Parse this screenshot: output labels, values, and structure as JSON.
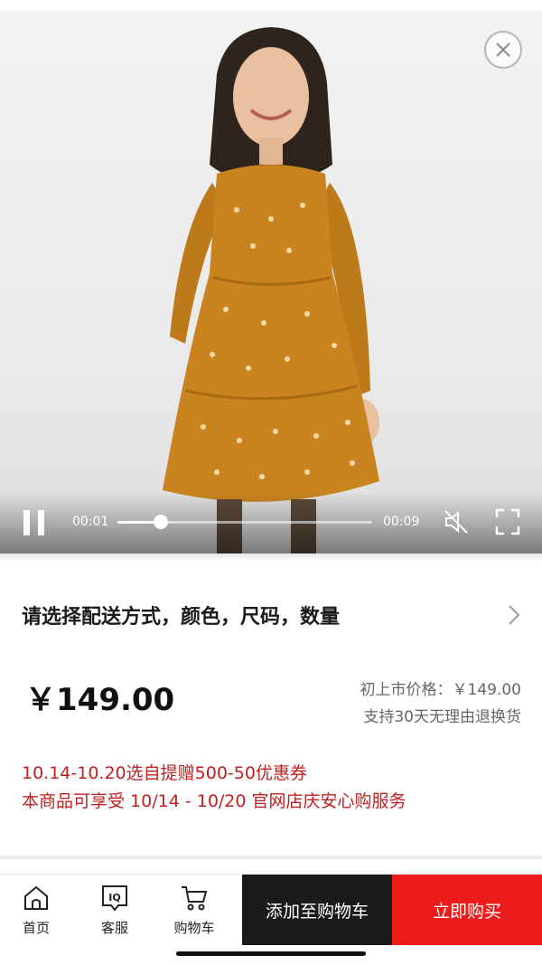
{
  "video": {
    "current_time": "00:01",
    "total_time": "00:09",
    "progress": 0.17
  },
  "product": {
    "options_prompt": "请选择配送方式，颜色，尺码，数量",
    "price": "￥149.00",
    "launch_price": "初上市价格：￥149.00",
    "return_policy": "支持30天无理由退换货",
    "promotions": [
      "10.14-10.20选自提赠500-50优惠券",
      "本商品可享受 10/14 - 10/20 官网店庆安心购服务"
    ]
  },
  "bottom_nav": {
    "home_label": "首页",
    "service_label": "客服",
    "cart_label": "购物车",
    "add_to_cart_label": "添加至购物车",
    "buy_now_label": "立即购买"
  },
  "colors": {
    "promo_red": "#c01f1f",
    "buy_button": "#ee1b1b",
    "cart_button": "#1b1b1b",
    "dress": "#c98420"
  },
  "icons": [
    "close-icon",
    "pause-icon",
    "mute-icon",
    "fullscreen-icon",
    "chevron-right-icon",
    "home-icon",
    "customer-service-icon",
    "shopping-cart-icon"
  ]
}
